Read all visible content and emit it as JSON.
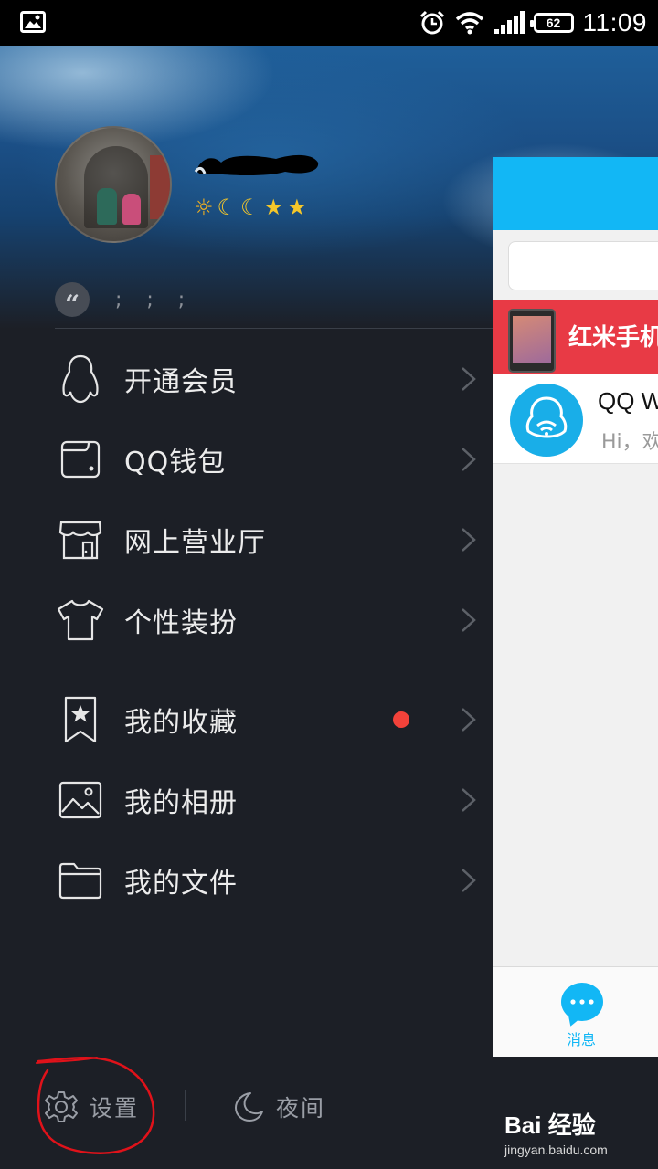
{
  "status_bar": {
    "battery": "62",
    "time": "11:09",
    "icons": [
      "image-icon",
      "alarm-icon",
      "wifi-icon",
      "signal-icon",
      "battery-icon"
    ]
  },
  "profile": {
    "level_icons": [
      "sun",
      "moon",
      "moon",
      "star",
      "star"
    ],
    "level_glyphs": [
      "☼",
      "☾",
      "☾",
      "★",
      "★"
    ],
    "signature": ";  ;  ;"
  },
  "menu": {
    "group1": [
      {
        "label": "开通会员",
        "icon": "penguin-icon"
      },
      {
        "label": "QQ钱包",
        "icon": "wallet-icon"
      },
      {
        "label": "网上营业厅",
        "icon": "store-icon"
      },
      {
        "label": "个性装扮",
        "icon": "tshirt-icon"
      }
    ],
    "group2": [
      {
        "label": "我的收藏",
        "icon": "bookmark-star-icon",
        "badge": true
      },
      {
        "label": "我的相册",
        "icon": "picture-icon"
      },
      {
        "label": "我的文件",
        "icon": "folder-icon"
      }
    ]
  },
  "bottom": {
    "settings_label": "设置",
    "night_label": "夜间"
  },
  "peek": {
    "banner_text": "红米手机",
    "chat_name": "QQ W",
    "chat_preview": "Hi，欢",
    "tab_label": "消息"
  },
  "watermark": {
    "brand": "Bai 经验",
    "url": "jingyan.baidu.com"
  },
  "colors": {
    "drawer_bg": "#1c1f26",
    "qq_blue": "#12b7f5",
    "badge_red": "#f2423a",
    "annotation_red": "#e0121a"
  }
}
